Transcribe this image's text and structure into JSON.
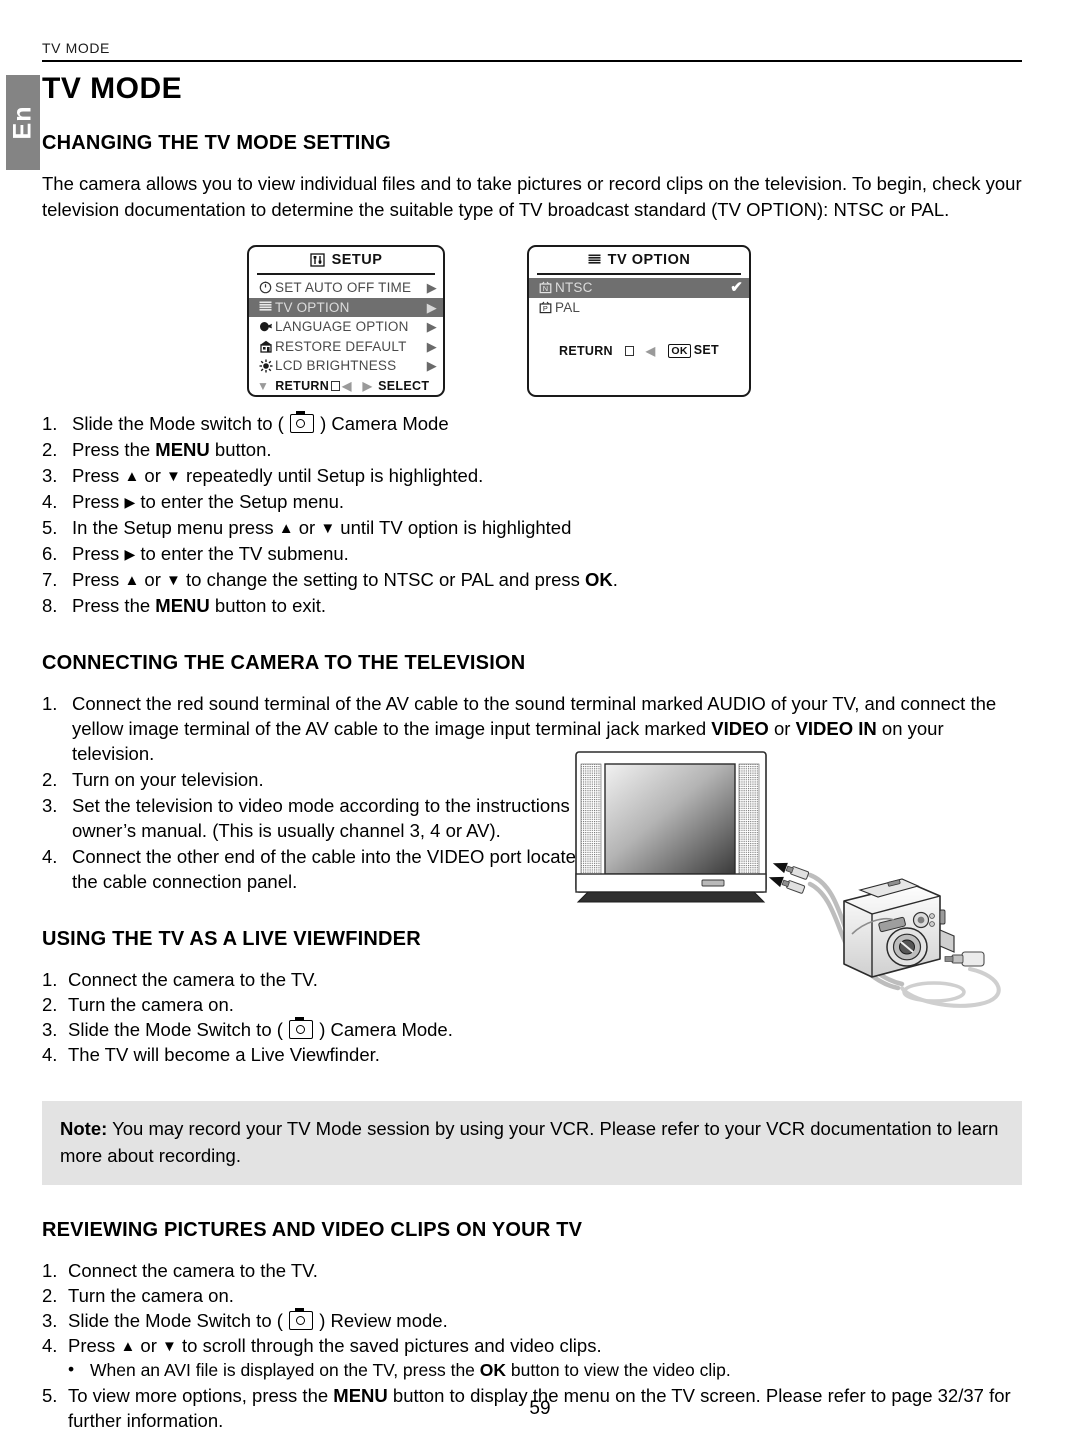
{
  "running_header": "TV MODE",
  "language_tab": "En",
  "page_title": "TV MODE",
  "page_number": "59",
  "sections": {
    "changing": {
      "heading": "CHANGING THE TV MODE SETTING",
      "intro": "The camera allows you to view individual files and to take pictures or record clips on the television. To begin, check your television documentation to determine the suitable type of TV broadcast standard (TV OPTION): NTSC or PAL.",
      "steps": [
        {
          "num": "1.",
          "pre": "Slide the Mode switch to ( ",
          "icon": "camera-mode-icon",
          "post": " ) Camera Mode"
        },
        {
          "num": "2.",
          "pre": "Press the ",
          "bold": "MENU",
          "post": " button."
        },
        {
          "num": "3.",
          "pre": "Press ",
          "arrows": "up-down",
          "post": " repeatedly until Setup is highlighted."
        },
        {
          "num": "4.",
          "pre": "Press ",
          "arrows": "right",
          "post": " to enter the Setup menu."
        },
        {
          "num": "5.",
          "pre": "In the Setup menu press ",
          "arrows": "up-down",
          "post": " until TV option is highlighted"
        },
        {
          "num": "6.",
          "pre": "Press ",
          "arrows": "right",
          "post": " to enter the TV submenu."
        },
        {
          "num": "7.",
          "pre": "Press ",
          "arrows": "up-down",
          "post": " to change the setting to NTSC or PAL and press ",
          "bold2": "OK",
          "post2": "."
        },
        {
          "num": "8.",
          "pre": "Press the ",
          "bold": "MENU",
          "post": " button to exit."
        }
      ]
    },
    "connecting": {
      "heading": "CONNECTING THE CAMERA TO THE TELEVISION",
      "steps": [
        {
          "num": "1.",
          "pre": "Connect the red sound terminal of the AV cable to the sound terminal marked AUDIO of your TV, and connect the yellow image terminal of the AV cable to the image input terminal jack marked ",
          "bold": "VIDEO",
          "mid": " or ",
          "bold2": "VIDEO IN",
          "post": " on your television."
        },
        {
          "num": "2.",
          "pre": "Turn on your television."
        },
        {
          "num": "3.",
          "pre": "Set the television to video mode according to the instructions in the owner’s manual. (This is usually channel 3, 4 or AV)."
        },
        {
          "num": "4.",
          "pre": "Connect the other end of the cable into the VIDEO port located in the cable connection panel."
        }
      ]
    },
    "viewfinder": {
      "heading": "USING THE TV AS A LIVE VIEWFINDER",
      "steps": [
        {
          "num": "1.",
          "pre": "Connect the camera to the TV."
        },
        {
          "num": "2.",
          "pre": "Turn the camera on."
        },
        {
          "num": "3.",
          "pre": "Slide the Mode Switch to ( ",
          "icon": "camera-mode-icon",
          "post": " ) Camera Mode."
        },
        {
          "num": "4.",
          "pre": "The TV will become a Live Viewfinder."
        }
      ]
    },
    "note": {
      "label": "Note:",
      "text": " You may record your TV Mode session by using your VCR. Please refer to your VCR documentation to learn more about recording."
    },
    "reviewing": {
      "heading": "REVIEWING PICTURES AND VIDEO CLIPS ON YOUR TV",
      "steps": [
        {
          "num": "1.",
          "pre": "Connect the camera to the TV."
        },
        {
          "num": "2.",
          "pre": "Turn the camera on."
        },
        {
          "num": "3.",
          "pre": "Slide the Mode Switch to ( ",
          "icon": "camera-mode-icon",
          "post": " ) Review mode."
        },
        {
          "num": "4.",
          "pre": "Press ",
          "arrows": "up-down",
          "post": " to scroll through the saved pictures and video clips."
        }
      ],
      "bullet": {
        "dot": "•",
        "pre": "When an AVI file is displayed on the TV, press the ",
        "bold": "OK",
        "post": " button to view the video clip."
      },
      "step5": {
        "num": "5.",
        "pre": "To view more options, press the ",
        "bold": "MENU",
        "post": " button to display the menu on the TV screen. Please refer to page 32/37 for further information."
      }
    }
  },
  "lcd_setup": {
    "title": "SETUP",
    "title_icon": "setup-sliders-icon",
    "rows": [
      {
        "icon": "auto-off-clock-icon",
        "label": "SET AUTO OFF TIME",
        "arrow": "▶",
        "selected": false
      },
      {
        "icon": "tv-option-list-icon",
        "label": "TV OPTION",
        "arrow": "▶",
        "selected": true
      },
      {
        "icon": "language-globe-icon",
        "label": "LANGUAGE OPTION",
        "arrow": "▶",
        "selected": false
      },
      {
        "icon": "restore-default-house-icon",
        "label": "RESTORE DEFAULT",
        "arrow": "▶",
        "selected": false
      },
      {
        "icon": "lcd-brightness-sun-icon",
        "label": "LCD BRIGHTNESS",
        "arrow": "▶",
        "selected": false
      }
    ],
    "footer": {
      "return": "RETURN",
      "select": "SELECT"
    }
  },
  "lcd_tv_option": {
    "title": "TV OPTION",
    "title_icon": "tv-option-list-icon",
    "rows": [
      {
        "icon": "ntsc-tv-icon",
        "label": "NTSC",
        "selected": true,
        "check": "✔"
      },
      {
        "icon": "pal-tv-icon",
        "label": "PAL",
        "selected": false,
        "check": ""
      }
    ],
    "footer": {
      "return": "RETURN",
      "ok": "OK",
      "set": "SET"
    }
  },
  "illustration": {
    "tv": "television-illustration",
    "camera": "digital-camera-illustration",
    "cable": "av-cable-illustration"
  },
  "colors": {
    "tab_gray": "#848484",
    "highlight_gray": "#6f6f6f",
    "note_gray": "#e3e3e3",
    "text": "#000000"
  }
}
